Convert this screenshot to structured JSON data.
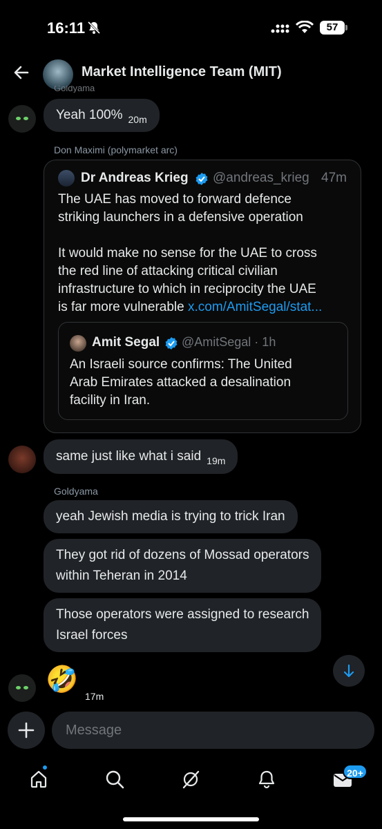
{
  "status_bar": {
    "time": "16:11",
    "battery": "57"
  },
  "header": {
    "title": "Market Intelligence Team (MIT)",
    "cut_sender": "Goldyama"
  },
  "messages": {
    "m1": {
      "text": "Yeah 100%",
      "time": "20m"
    },
    "m2_sender": "Don Maximi (polymarket arc)",
    "m3": {
      "text": "same just like what i said",
      "time": "19m"
    },
    "m4_sender": "Goldyama",
    "m4": {
      "text": "yeah Jewish media is trying to trick Iran"
    },
    "m5": {
      "line1": "They got rid of dozens of Mossad operators",
      "line2": "within Teheran in 2014"
    },
    "m6": {
      "line1": "Those operators were assigned to research",
      "line2": "Israel forces"
    },
    "m7": {
      "emoji": "🤣",
      "time": "17m"
    }
  },
  "tweet": {
    "author": "Dr Andreas Krieg",
    "handle": "@andreas_krieg",
    "time": "47m",
    "para1_line1": "The UAE has moved to forward defence",
    "para1_line2": "striking launchers in a defensive operation",
    "para2_line1": "It would make no sense for the UAE to cross",
    "para2_line2": "the red line of attacking critical civilian",
    "para2_line3": "infrastructure to which in reciprocity the UAE",
    "para2_line4": "is far more vulnerable ",
    "link": "x.com/AmitSegal/stat...",
    "quoted": {
      "author": "Amit Segal",
      "handle": "@AmitSegal · 1h",
      "line1": "An Israeli source confirms: The United",
      "line2": "Arab Emirates attacked a desalination",
      "line3": "facility in Iran."
    }
  },
  "composer": {
    "placeholder": "Message"
  },
  "tabbar": {
    "messages_badge": "20+"
  },
  "colors": {
    "accent": "#1d9bf0",
    "bubble": "#202327",
    "background": "#000000"
  },
  "icons": [
    "back-arrow-icon",
    "verified-badge-icon",
    "chevron-down-icon",
    "plus-icon",
    "home-icon",
    "search-icon",
    "grok-icon",
    "bell-icon",
    "mail-icon",
    "bell-slash-icon",
    "signal-icon",
    "wifi-icon"
  ]
}
